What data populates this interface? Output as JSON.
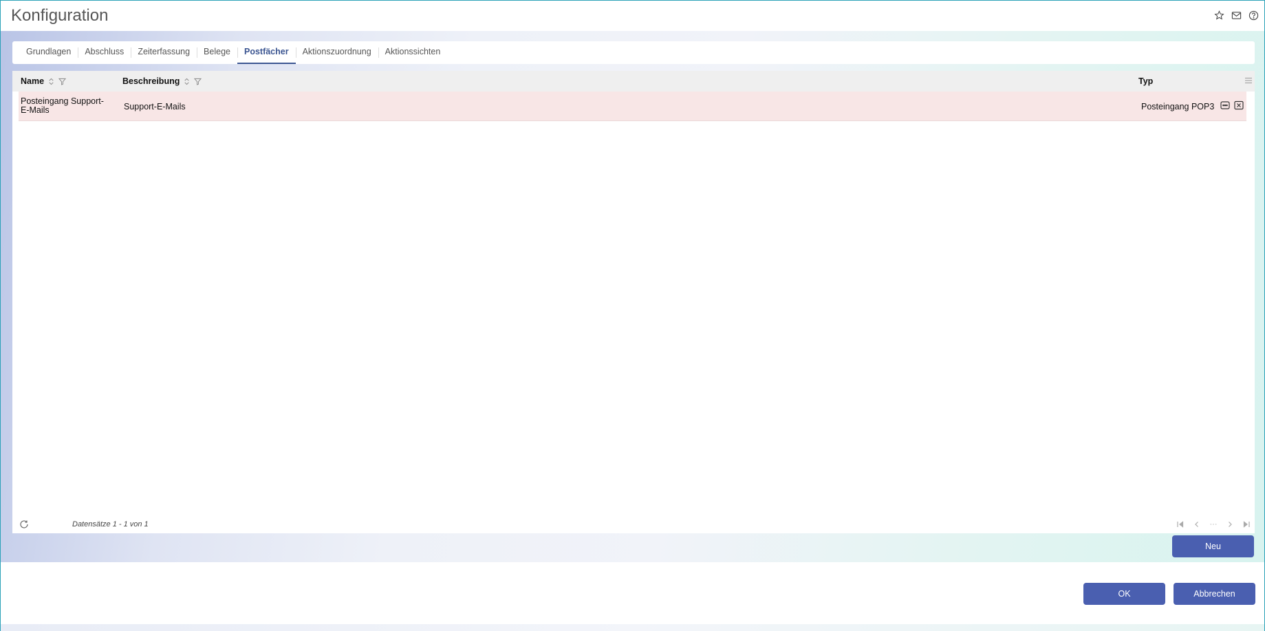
{
  "window": {
    "title": "Konfiguration",
    "icons": [
      "star-icon",
      "mail-icon",
      "help-icon"
    ]
  },
  "tabs": [
    {
      "label": "Grundlagen",
      "active": false
    },
    {
      "label": "Abschluss",
      "active": false
    },
    {
      "label": "Zeiterfassung",
      "active": false
    },
    {
      "label": "Belege",
      "active": false
    },
    {
      "label": "Postfächer",
      "active": true
    },
    {
      "label": "Aktionszuordnung",
      "active": false
    },
    {
      "label": "Aktionssichten",
      "active": false
    }
  ],
  "grid": {
    "columns": {
      "name": "Name",
      "beschreibung": "Beschreibung",
      "typ": "Typ"
    },
    "rows": [
      {
        "name": "Posteingang Support-E-Mails",
        "beschreibung": "Support-E-Mails",
        "typ": "Posteingang POP3"
      }
    ],
    "footer": {
      "record_count": "Datensätze 1 - 1 von 1",
      "pager_ellipsis": "···"
    }
  },
  "buttons": {
    "new": "Neu",
    "ok": "OK",
    "cancel": "Abbrechen"
  },
  "colors": {
    "accent": "#3b5591",
    "button": "#4a5fb0",
    "selected_row": "#f8e6e6",
    "header_bg": "#efefef"
  }
}
